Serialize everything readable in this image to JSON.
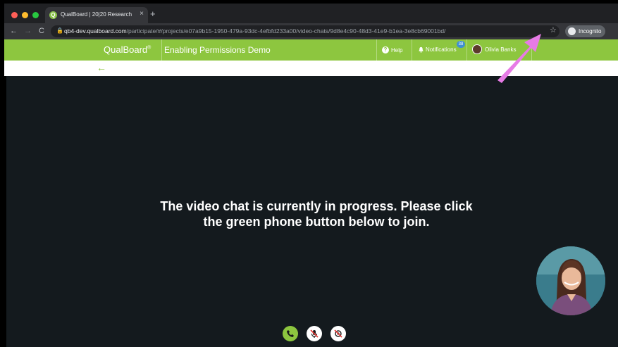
{
  "browser": {
    "tab_title": "QualBoard | 20|20 Research",
    "tab_close": "×",
    "new_tab": "+",
    "url_host": "qb4-dev.qualboard.com",
    "url_path": "/participate/#/projects/e07a9b15-1950-479a-93dc-4efbfd233a00/video-chats/9d8e4c90-48d3-41e9-b1ea-3e8cb69001bd/",
    "incognito_label": "Incognito"
  },
  "header": {
    "logo": "QualBoard",
    "logo_mark": "®",
    "project_title": "Enabling Permissions Demo",
    "help_label": "Help",
    "notifications_label": "Notifications",
    "notifications_count": "38",
    "user_name": "Olivia Banks"
  },
  "video": {
    "message": "The video chat is currently in progress. Please click the green phone button below to join."
  },
  "icons": {
    "favicon": "qualboard-favicon",
    "camera_blocked": "camera-blocked-icon",
    "join_call": "phone-icon",
    "mute": "microphone-muted-icon",
    "camera_off": "camera-off-icon"
  },
  "colors": {
    "brand_green": "#8dc63f",
    "video_bg": "#141a1e",
    "badge_blue": "#3f8fd2",
    "annotation_pink": "#e77be6"
  }
}
